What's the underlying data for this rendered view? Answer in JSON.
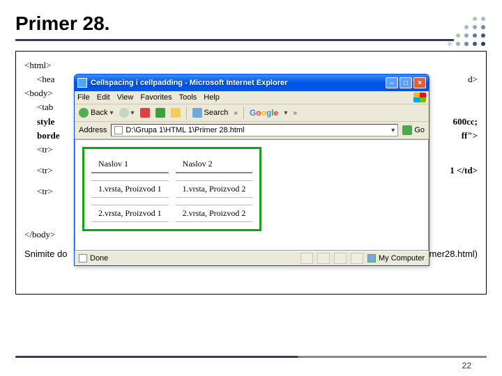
{
  "slide": {
    "title": "Primer 28.",
    "page_number": "22",
    "save_hint_left": "Snimite do",
    "save_hint_right": "mer28.html)"
  },
  "code": {
    "l1": "<html>",
    "l2_left": "<hea",
    "l2_right": "d>",
    "l3": "<body>",
    "l4": "<tab",
    "l5_left": "style",
    "l5_right": "600cc;",
    "l6_left": "borde",
    "l6_right": "ff\">",
    "l7": "<tr>",
    "l8_left": "<tr>",
    "l8_right": "1 </td>",
    "l9": "<tr>",
    "l10": "</body>"
  },
  "ie": {
    "title": "Cellspacing i cellpadding - Microsoft Internet Explorer",
    "menu": {
      "file": "File",
      "edit": "Edit",
      "view": "View",
      "favorites": "Favorites",
      "tools": "Tools",
      "help": "Help"
    },
    "toolbar": {
      "back": "Back",
      "search": "Search"
    },
    "addr": {
      "label": "Address",
      "value": "D:\\Grupa 1\\HTML 1\\Primer 28.html",
      "go": "Go"
    },
    "status": {
      "done": "Done",
      "zone": "My Computer"
    },
    "table": {
      "h1": "Naslov 1",
      "h2": "Naslov 2",
      "r1c1": "1.vrsta, Proizvod 1",
      "r1c2": "1.vrsta, Proizvod 2",
      "r2c1": "2.vrsta, Proizvod 1",
      "r2c2": "2.vrsta, Proizvod 2"
    }
  }
}
